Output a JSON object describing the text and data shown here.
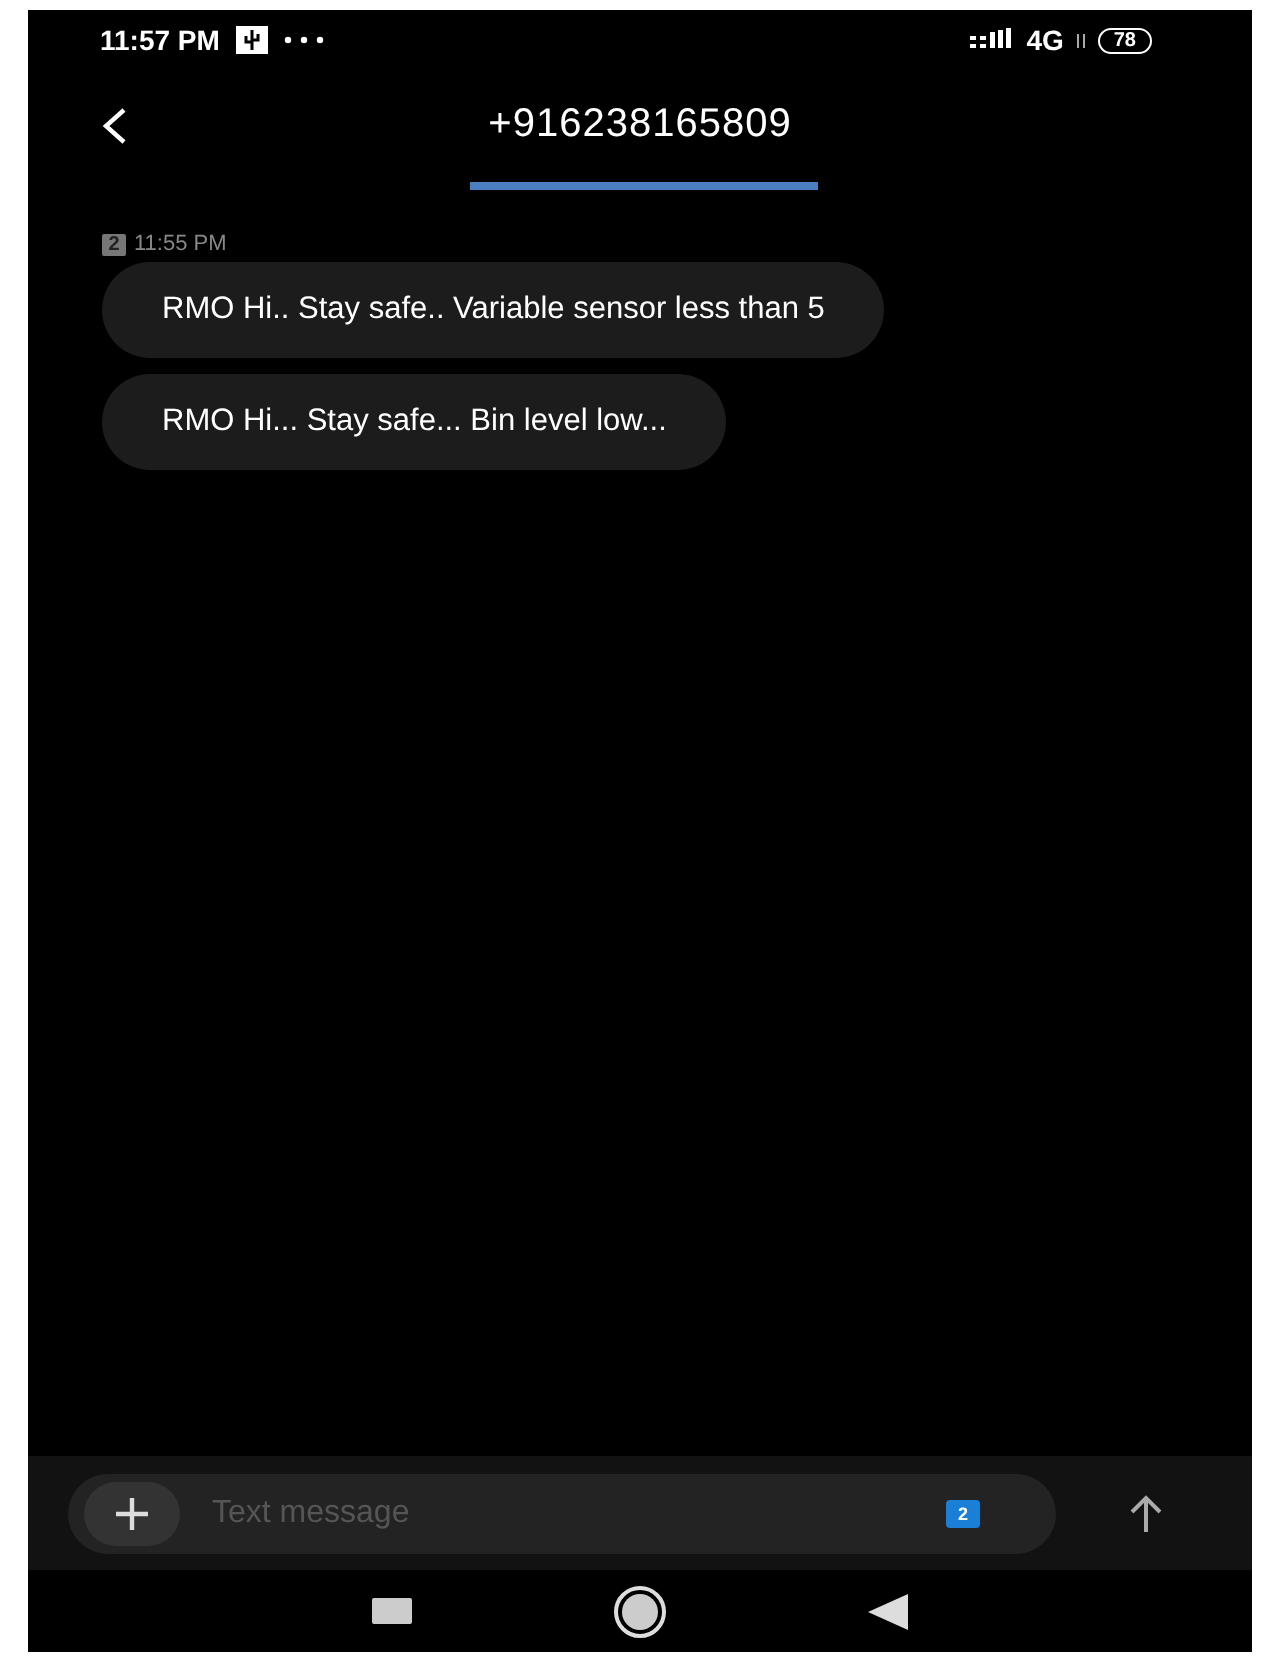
{
  "status_bar": {
    "time": "11:57 PM",
    "network": "4G",
    "battery": "78"
  },
  "header": {
    "title": "+916238165809"
  },
  "conversation": {
    "sim_badge": "2",
    "time": "11:55 PM",
    "messages": [
      {
        "text": "RMO Hi.. Stay safe.. Variable sensor less than 5"
      },
      {
        "text": "RMO Hi... Stay safe... Bin level low..."
      }
    ]
  },
  "composer": {
    "placeholder": "Text message",
    "sim_badge": "2"
  }
}
